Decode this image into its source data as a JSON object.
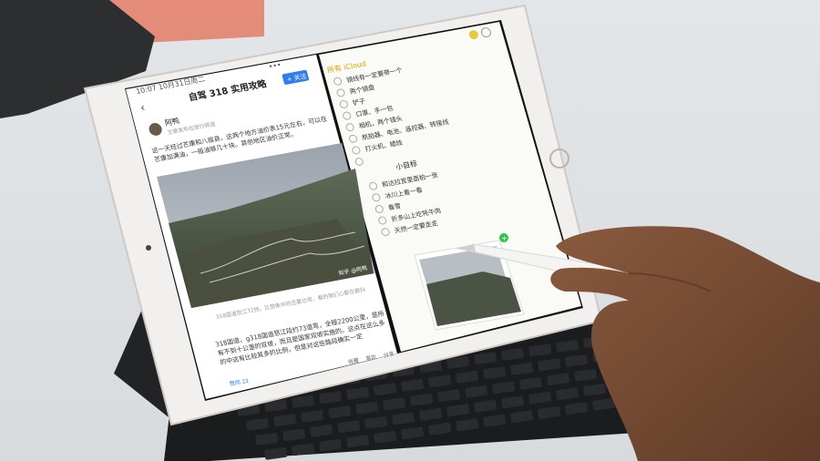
{
  "status_bar": {
    "time": "10:07 10月31日周二"
  },
  "article": {
    "title": "自驾 318 实用攻略",
    "follow_label": "+ 关注",
    "author": "阿鸭",
    "author_meta": "文章发布在旅行频道",
    "paragraph1": "这一天经过芒康和八宿县，这两个地方油价表15元左右，可以在芒康加满油，一般油够几十块。其他地区油价正常。",
    "photo_watermark": "知乎 @阿鸭",
    "photo_caption": "318国道怒江72拐，比想象中的还要壮观，看的我们心都在颤抖",
    "paragraph2": "318国道、g318国道怒江段约73道弯，全程2200公里，是所有不到十公里的双坡，而且是国家双坡实施的。这点在这么多的中这有比较其多的比例，但是对这些路段确实一定",
    "bottom_left": "赞同 22",
    "bottom_icons": [
      "收藏",
      "喜欢",
      "分享"
    ]
  },
  "notes": {
    "back_label": "所有 iCloud",
    "list1": [
      "镜线有一定要带一个",
      "两个镜盘",
      "铲子",
      "口罩、手一包",
      "相机，两个镜头",
      "航拍器、电池、遥控器、转接线",
      "打火机、蜡烛",
      ""
    ],
    "subheading": "小目标",
    "list2": [
      "和达拉宫里面拍一张",
      "冰川上看一看",
      "看雪",
      "折多山上吃牦牛肉",
      "天然一定要走走"
    ]
  },
  "colors": {
    "accent": "#2f7ef0",
    "ipad_frame": "#f1f0ee",
    "pencil": "#f4f4f2",
    "green_badge": "#2ec251"
  }
}
